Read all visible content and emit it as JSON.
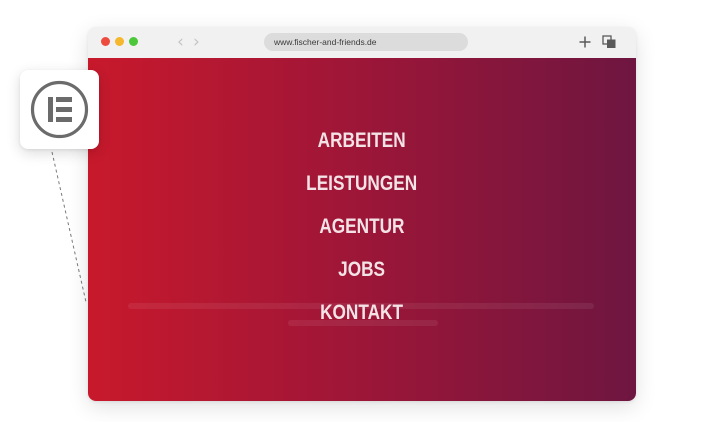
{
  "browser": {
    "url": "www.fischer-and-friends.de",
    "nav_back_glyph": "‹",
    "nav_forward_glyph": "›",
    "icons": [
      "close-dot",
      "minimize-dot",
      "maximize-dot",
      "plus-icon",
      "tabs-icon"
    ]
  },
  "menu": {
    "items": [
      {
        "label": "ARBEITEN"
      },
      {
        "label": "LEISTUNGEN"
      },
      {
        "label": "AGENTUR"
      },
      {
        "label": "JOBS"
      },
      {
        "label": "KONTAKT"
      }
    ]
  },
  "badge": {
    "icon": "elementor-icon"
  },
  "colors": {
    "gradient_start": "#c8192c",
    "gradient_end": "#6e1640",
    "menu_text": "#f3e3e6",
    "badge_icon": "#6b6b6b"
  }
}
